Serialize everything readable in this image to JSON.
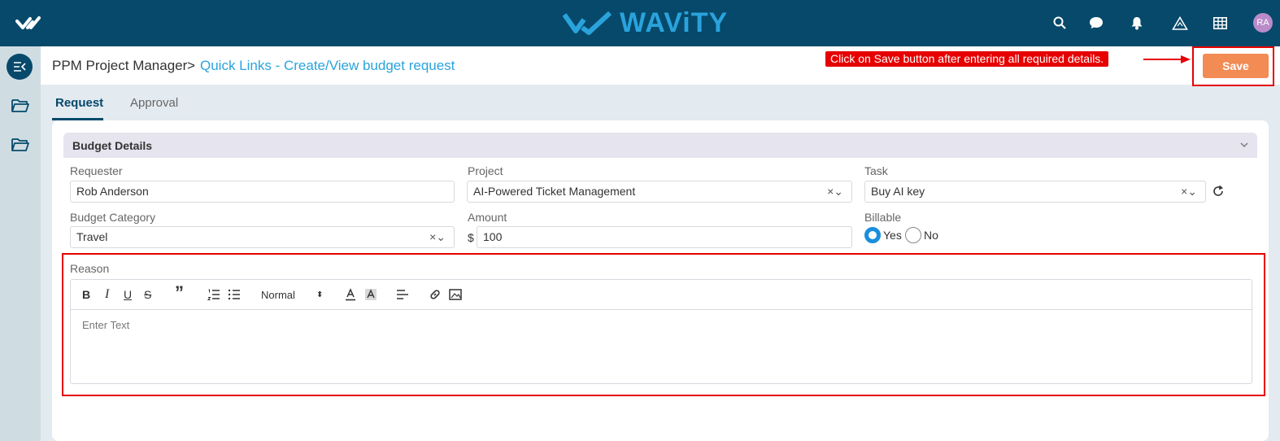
{
  "brand": {
    "name": "WAViTY"
  },
  "topbar": {
    "icons": [
      "search-icon",
      "chat-icon",
      "bell-icon",
      "alert-triangle-icon",
      "grid-icon"
    ],
    "avatar_initials": "RA"
  },
  "breadcrumb": {
    "root": "PPM Project Manager",
    "separator": ">",
    "current": "Quick Links - Create/View budget request"
  },
  "annotation": {
    "text": "Click on Save button after entering all required details."
  },
  "save_label": "Save",
  "tabs": [
    {
      "label": "Request",
      "active": true
    },
    {
      "label": "Approval",
      "active": false
    }
  ],
  "section": {
    "title": "Budget Details"
  },
  "fields": {
    "requester": {
      "label": "Requester",
      "value": "Rob Anderson"
    },
    "project": {
      "label": "Project",
      "value": "AI-Powered Ticket Management"
    },
    "task": {
      "label": "Task",
      "value": "Buy AI key"
    },
    "budget_category": {
      "label": "Budget Category",
      "value": "Travel"
    },
    "amount": {
      "label": "Amount",
      "currency": "$",
      "value": "100"
    },
    "billable": {
      "label": "Billable",
      "options": [
        "Yes",
        "No"
      ],
      "selected": "Yes"
    }
  },
  "select_controls": "×⌄",
  "reason": {
    "label": "Reason",
    "placeholder": "Enter Text",
    "toolbar": {
      "bold": "B",
      "italic": "I",
      "underline": "U",
      "strike": "S",
      "quote": "”",
      "text_size": "Normal",
      "size_control": "⬍"
    }
  },
  "colors": {
    "topbar": "#06496b",
    "brand": "#2aa3dc",
    "save_button": "#f28b54",
    "annotation": "#e60000",
    "radio_selected": "#1a8fdc"
  }
}
